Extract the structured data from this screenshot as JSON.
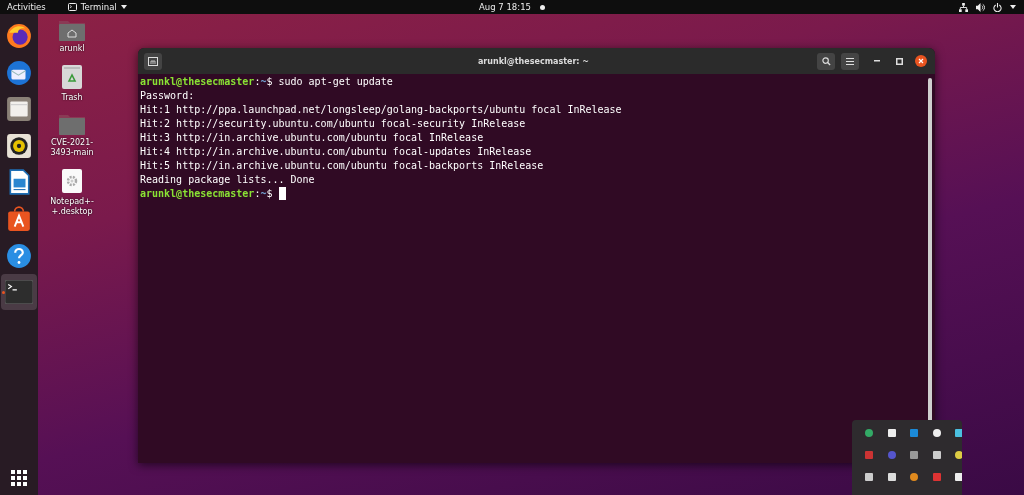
{
  "top_bar": {
    "activities": "Activities",
    "app_menu": "Terminal",
    "clock": "Aug 7  18:15",
    "notification_dot": true
  },
  "dock": {
    "items": [
      {
        "kind": "browser",
        "selected": false,
        "running": false
      },
      {
        "kind": "mail",
        "selected": false,
        "running": false
      },
      {
        "kind": "files",
        "selected": false,
        "running": false
      },
      {
        "kind": "music",
        "selected": false,
        "running": false
      },
      {
        "kind": "writer",
        "selected": false,
        "running": false
      },
      {
        "kind": "store",
        "selected": false,
        "running": false
      },
      {
        "kind": "help",
        "selected": false,
        "running": false
      },
      {
        "kind": "terminal",
        "selected": true,
        "running": true
      }
    ]
  },
  "desktop_icons": [
    {
      "kind": "home",
      "label": "arunkl"
    },
    {
      "kind": "trash",
      "label": "Trash"
    },
    {
      "kind": "folder",
      "label": "CVE-2021-3493-main"
    },
    {
      "kind": "file",
      "label": "Notepad+-+.desktop"
    }
  ],
  "terminal": {
    "title": "arunkl@thesecmaster: ~",
    "lines": [
      {
        "kind": "prompt",
        "user": "arunkl@thesecmaster",
        "separator": ":",
        "path": "~",
        "symbol": "$",
        "command": "sudo apt-get update"
      },
      {
        "kind": "output",
        "text": "Password:"
      },
      {
        "kind": "output",
        "text": "Hit:1 http://ppa.launchpad.net/longsleep/golang-backports/ubuntu focal InRelease"
      },
      {
        "kind": "output",
        "text": "Hit:2 http://security.ubuntu.com/ubuntu focal-security InRelease"
      },
      {
        "kind": "output",
        "text": "Hit:3 http://in.archive.ubuntu.com/ubuntu focal InRelease"
      },
      {
        "kind": "output",
        "text": "Hit:4 http://in.archive.ubuntu.com/ubuntu focal-updates InRelease"
      },
      {
        "kind": "output",
        "text": "Hit:5 http://in.archive.ubuntu.com/ubuntu focal-backports InRelease"
      },
      {
        "kind": "output",
        "text": "Reading package lists... Done"
      },
      {
        "kind": "prompt",
        "user": "arunkl@thesecmaster",
        "separator": ":",
        "path": "~",
        "symbol": "$",
        "cursor": true
      }
    ]
  }
}
